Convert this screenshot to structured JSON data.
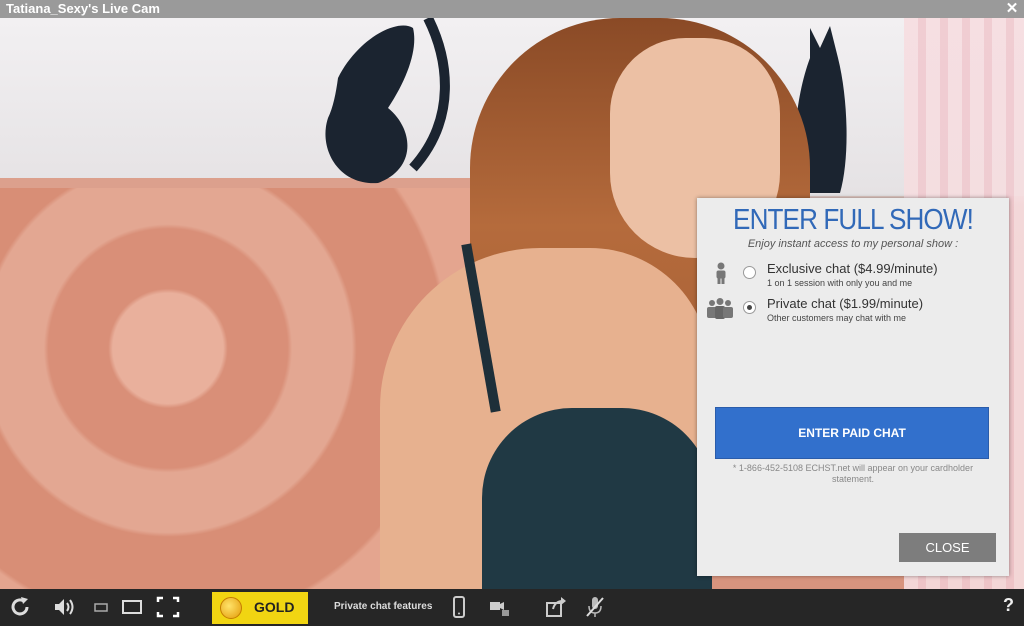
{
  "window": {
    "title": "Tatiana_Sexy's Live Cam",
    "close_glyph": "✕"
  },
  "modal": {
    "title": "ENTER FULL SHOW!",
    "subtitle": "Enjoy instant access to my personal show :",
    "options": [
      {
        "label": "Exclusive chat ($4.99/minute)",
        "description": "1 on 1 session with only you and me",
        "selected": false,
        "icon": "single-person-icon"
      },
      {
        "label": "Private chat ($1.99/minute)",
        "description": "Other customers may chat with me",
        "selected": true,
        "icon": "group-people-icon"
      }
    ],
    "enter_button": "ENTER PAID CHAT",
    "note": "* 1-866-452-5108 ECHST.net will appear on your cardholder statement.",
    "close_button": "CLOSE",
    "accent_color": "#3169b8"
  },
  "toolbar": {
    "gold_label": "GOLD",
    "private_features_label": "Private chat features",
    "help_glyph": "?",
    "icons": [
      "refresh-icon",
      "volume-icon",
      "size-small-icon",
      "size-medium-icon",
      "fullscreen-icon",
      "mobile-icon",
      "cam-to-cam-icon",
      "share-icon",
      "mute-mic-icon",
      "help-icon"
    ]
  }
}
